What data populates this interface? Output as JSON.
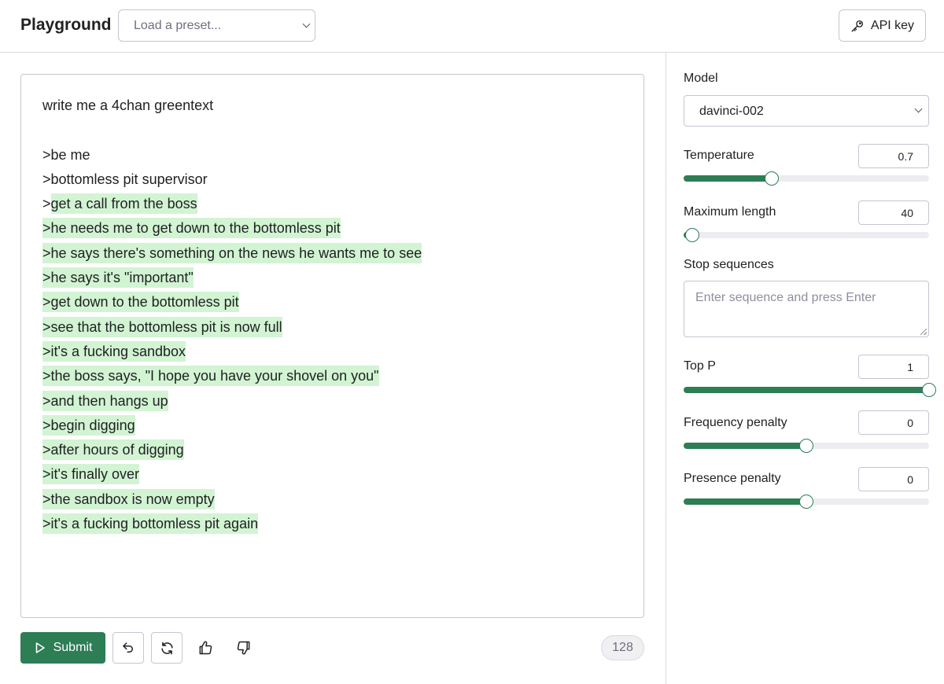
{
  "app": {
    "title": "Playground"
  },
  "header": {
    "preset_placeholder": "Load a preset...",
    "api_key_label": "API key"
  },
  "editor": {
    "lines": [
      {
        "plain": "write me a 4chan greentext",
        "hl": ""
      },
      {
        "plain": "",
        "hl": ""
      },
      {
        "plain": ">be me",
        "hl": ""
      },
      {
        "plain": ">bottomless pit supervisor",
        "hl": ""
      },
      {
        "plain": ">",
        "hl": "get a call from the boss"
      },
      {
        "plain": "",
        "hl": ">he needs me to get down to the bottomless pit"
      },
      {
        "plain": "",
        "hl": ">he says there's something on the news he wants me to see"
      },
      {
        "plain": "",
        "hl": ">he says it's \"important\""
      },
      {
        "plain": "",
        "hl": ">get down to the bottomless pit"
      },
      {
        "plain": "",
        "hl": ">see that the bottomless pit is now full"
      },
      {
        "plain": "",
        "hl": ">it's a fucking sandbox"
      },
      {
        "plain": "",
        "hl": ">the boss says, \"I hope you have your shovel on you\""
      },
      {
        "plain": "",
        "hl": ">and then hangs up"
      },
      {
        "plain": "",
        "hl": ">begin digging"
      },
      {
        "plain": "",
        "hl": ">after hours of digging"
      },
      {
        "plain": "",
        "hl": ">it's finally over"
      },
      {
        "plain": "",
        "hl": ">the sandbox is now empty"
      },
      {
        "plain": "",
        "hl": ">it's a fucking bottomless pit again"
      }
    ]
  },
  "toolbar": {
    "submit_label": "Submit",
    "token_count": "128"
  },
  "settings": {
    "model": {
      "label": "Model",
      "value": "davinci-002"
    },
    "temperature": {
      "label": "Temperature",
      "value": "0.7",
      "slider_fraction": 0.36
    },
    "max_length": {
      "label": "Maximum length",
      "value": "40",
      "slider_fraction": 0.035
    },
    "stop_sequences": {
      "label": "Stop sequences",
      "placeholder": "Enter sequence and press Enter"
    },
    "top_p": {
      "label": "Top P",
      "value": "1",
      "slider_fraction": 1.0
    },
    "frequency_penalty": {
      "label": "Frequency penalty",
      "value": "0",
      "slider_fraction": 0.5
    },
    "presence_penalty": {
      "label": "Presence penalty",
      "value": "0",
      "slider_fraction": 0.5
    }
  },
  "colors": {
    "accent": "#2d7d55",
    "highlight": "#d2f4d3",
    "border": "#c5c5d2"
  },
  "icons": {
    "api_key": "key-icon",
    "submit": "play-icon",
    "undo": "undo-icon",
    "regenerate": "regenerate-icon",
    "thumbs_up": "thumbs-up-icon",
    "thumbs_down": "thumbs-down-icon"
  }
}
